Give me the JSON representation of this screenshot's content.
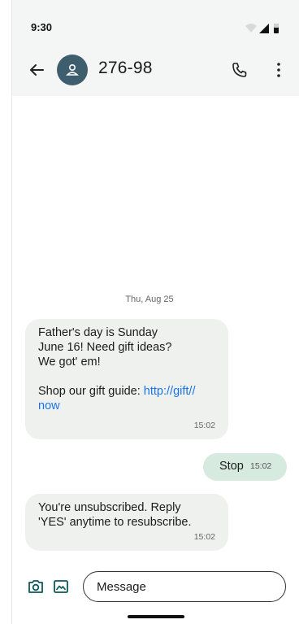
{
  "status": {
    "time": "9:30",
    "icons": [
      "wifi-icon",
      "signal-icon",
      "battery-icon"
    ]
  },
  "header": {
    "title": "276-98",
    "icons": [
      "back-arrow-icon",
      "contact-avatar-icon",
      "phone-icon",
      "more-vert-icon"
    ]
  },
  "conversation": {
    "date": "Thu, Aug 25",
    "messages": [
      {
        "direction": "in",
        "text": "Father's day is Sunday\nJune 16! Need gift ideas?\nWe got' em!\n\nShop our gift guide: ",
        "link": "http://gift//\nnow",
        "time": "15:02"
      },
      {
        "direction": "out",
        "text": "Stop",
        "time": "15:02"
      },
      {
        "direction": "in",
        "text": "You're unsubscribed. Reply\n'YES' anytime to resubscribe.",
        "time": "15:02"
      }
    ]
  },
  "composer": {
    "placeholder": "Message",
    "icons": [
      "camera-icon",
      "gallery-icon"
    ]
  },
  "colors": {
    "header_bg": "#f3f6f5",
    "avatar": "#3f5e6d",
    "incoming_bubble": "#eff1ee",
    "outgoing_bubble": "#d6eae0",
    "link": "#1a73e8"
  }
}
